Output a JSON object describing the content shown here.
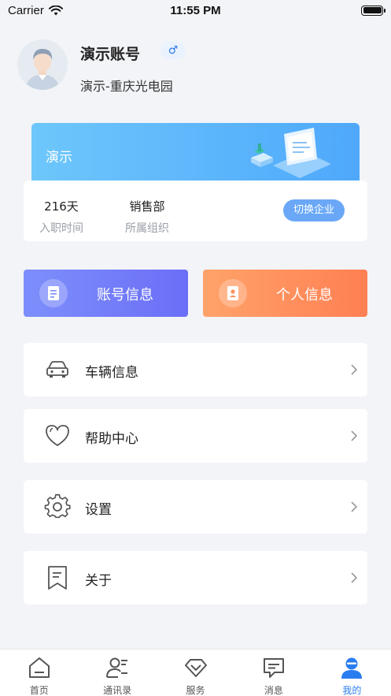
{
  "status_bar": {
    "carrier": "Carrier",
    "time": "11:55 PM"
  },
  "profile": {
    "name": "演示账号",
    "gender_symbol": "♂",
    "company": "演示-重庆光电园"
  },
  "enterprise": {
    "banner_title": "演示",
    "stats": [
      {
        "value": "216天",
        "label": "入职时间"
      },
      {
        "value": "销售部",
        "label": "所属组织"
      }
    ],
    "switch_label": "切换企业"
  },
  "actions": {
    "account_info": "账号信息",
    "personal_info": "个人信息"
  },
  "menu": [
    {
      "label": "车辆信息",
      "icon": "car-icon"
    },
    {
      "label": "帮助中心",
      "icon": "heart-icon"
    },
    {
      "label": "设置",
      "icon": "gear-icon"
    },
    {
      "label": "关于",
      "icon": "bookmark-icon"
    }
  ],
  "tabs": [
    {
      "label": "首页",
      "icon": "home-icon"
    },
    {
      "label": "通讯录",
      "icon": "contacts-icon"
    },
    {
      "label": "服务",
      "icon": "diamond-icon"
    },
    {
      "label": "消息",
      "icon": "message-icon"
    },
    {
      "label": "我的",
      "icon": "user-icon",
      "active": true
    }
  ],
  "colors": {
    "accent": "#2a7df0",
    "account_gradient": [
      "#7d8ffb",
      "#6b6ef7"
    ],
    "personal_gradient": [
      "#ffa36a",
      "#ff7f53"
    ],
    "banner_gradient": [
      "#6dc7fb",
      "#4fa8fb"
    ]
  }
}
